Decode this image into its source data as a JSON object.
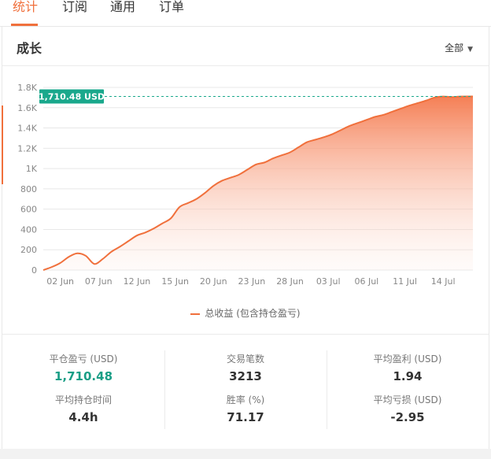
{
  "tabs": [
    "统计",
    "订阅",
    "通用",
    "订单"
  ],
  "section": {
    "title": "成长",
    "range": "全部"
  },
  "chart_data": {
    "type": "area",
    "y_ticks": [
      "0",
      "200",
      "400",
      "600",
      "800",
      "1K",
      "1.2K",
      "1.4K",
      "1.6K",
      "1.8K"
    ],
    "y_tick_values": [
      0,
      200,
      400,
      600,
      800,
      1000,
      1200,
      1400,
      1600,
      1800
    ],
    "ylim": [
      0,
      1800
    ],
    "x_ticks": [
      "02 Jun",
      "07 Jun",
      "12 Jun",
      "15 Jun",
      "20 Jun",
      "23 Jun",
      "28 Jun",
      "03 Jul",
      "06 Jul",
      "11 Jul",
      "14 Jul"
    ],
    "x_tick_positions": [
      2,
      6.5,
      11,
      15.5,
      20,
      24.5,
      29,
      33.5,
      38,
      42.5,
      47
    ],
    "xlim": [
      0,
      50.5
    ],
    "series": [
      {
        "name": "总收益 (包含持仓盈亏)",
        "x": [
          0,
          1,
          2,
          3,
          4,
          5,
          6,
          7,
          8,
          9,
          10,
          11,
          12,
          13,
          14,
          15,
          16,
          17,
          18,
          19,
          20,
          21,
          22,
          23,
          24,
          25,
          26,
          27,
          28,
          29,
          30,
          31,
          32,
          33,
          34,
          35,
          36,
          37,
          38,
          39,
          40,
          41,
          42,
          43,
          44,
          45,
          46,
          47,
          48,
          49,
          50.5
        ],
        "y": [
          0,
          30,
          70,
          130,
          165,
          140,
          60,
          110,
          180,
          230,
          285,
          340,
          370,
          410,
          460,
          510,
          620,
          660,
          700,
          760,
          830,
          880,
          910,
          940,
          990,
          1040,
          1060,
          1100,
          1130,
          1160,
          1210,
          1260,
          1285,
          1310,
          1340,
          1380,
          1420,
          1450,
          1480,
          1510,
          1530,
          1560,
          1590,
          1620,
          1645,
          1670,
          1700,
          1710,
          1705,
          1710,
          1710.48
        ]
      }
    ],
    "highlight_label": "1,710.48 USD",
    "highlight_value": 1710.48,
    "grid": true,
    "legend_position": "bottom-center",
    "colors": {
      "line": "#f0703c",
      "fill_top": "#f57f55",
      "highlight": "#1aa88c"
    }
  },
  "stats": {
    "pnl_label": "平仓盈亏 (USD)",
    "pnl_value": "1,710.48",
    "trades_label": "交易笔数",
    "trades_value": "3213",
    "avg_profit_label": "平均盈利 (USD)",
    "avg_profit_value": "1.94",
    "avg_hold_label": "平均持仓时间",
    "avg_hold_value": "4.4h",
    "winrate_label": "胜率 (%)",
    "winrate_value": "71.17",
    "avg_loss_label": "平均亏损 (USD)",
    "avg_loss_value": "-2.95"
  }
}
